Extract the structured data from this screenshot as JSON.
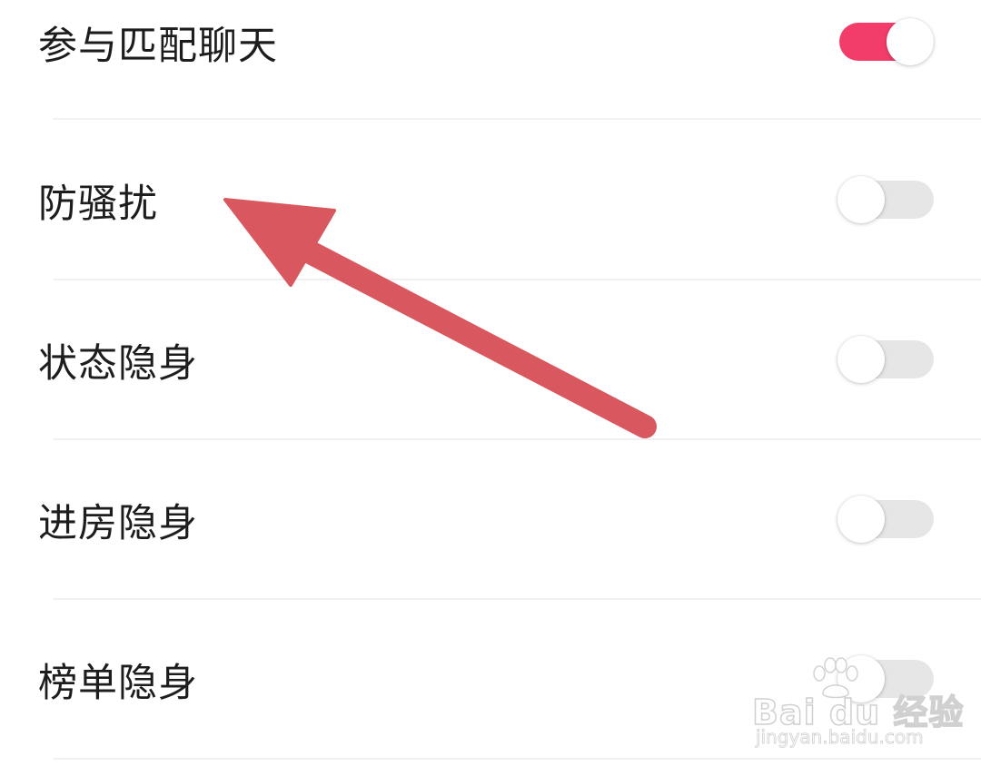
{
  "settings": {
    "items": [
      {
        "label": "参与匹配聊天",
        "enabled": true
      },
      {
        "label": "防骚扰",
        "enabled": false
      },
      {
        "label": "状态隐身",
        "enabled": false
      },
      {
        "label": "进房隐身",
        "enabled": false
      },
      {
        "label": "榜单隐身",
        "enabled": false
      }
    ]
  },
  "annotation": {
    "arrow_color": "#d9575e"
  },
  "colors": {
    "toggle_on": "#f23d6b",
    "toggle_off": "#e6e6e6",
    "divider": "#f1f1f1",
    "text": "#1d1d1d"
  },
  "watermark": {
    "brand": "Bai du 经验",
    "url": "jingyan.baidu.com"
  }
}
